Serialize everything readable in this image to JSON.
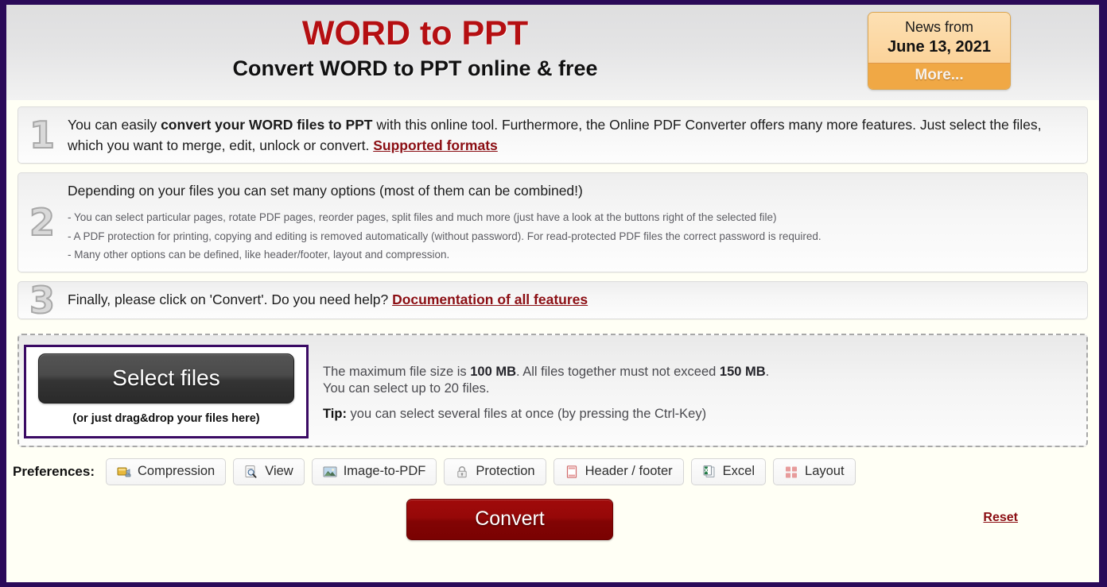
{
  "header": {
    "title": "WORD to PPT",
    "subtitle": "Convert WORD to PPT online & free",
    "news": {
      "line1": "News from",
      "date": "June 13, 2021",
      "more_label": "More..."
    }
  },
  "steps": [
    {
      "number": "1",
      "text_before": "You can easily ",
      "bold": "convert your WORD files to PPT",
      "text_after": " with this online tool. Furthermore, the Online PDF Converter offers many more features. Just select the files, which you want to merge, edit, unlock or convert. ",
      "link": "Supported formats"
    },
    {
      "number": "2",
      "text": "Depending on your files you can set many options (most of them can be combined!)",
      "bullets": [
        "- You can select particular pages, rotate PDF pages, reorder pages, split files and much more (just have a look at the buttons right of the selected file)",
        "- A PDF protection for printing, copying and editing is removed automatically (without password). For read-protected PDF files the correct password is required.",
        "- Many other options can be defined, like header/footer, layout and compression."
      ]
    },
    {
      "number": "3",
      "text": "Finally, please click on 'Convert'. Do you need help? ",
      "link": "Documentation of all features"
    }
  ],
  "dropzone": {
    "select_files_label": "Select files",
    "dragdrop_note": "(or just drag&drop your files here)",
    "info_line1_a": "The maximum file size is ",
    "info_line1_b": "100 MB",
    "info_line1_c": ". All files together must not exceed ",
    "info_line1_d": "150 MB",
    "info_line1_e": ".",
    "info_line2": "You can select up to 20 files.",
    "tip_label": "Tip:",
    "tip_text": " you can select several files at once (by pressing the Ctrl-Key)"
  },
  "preferences": {
    "label": "Preferences:",
    "items": [
      {
        "label": "Compression",
        "icon": "compression-icon"
      },
      {
        "label": "View",
        "icon": "view-magnifier-icon"
      },
      {
        "label": "Image-to-PDF",
        "icon": "image-icon"
      },
      {
        "label": "Protection",
        "icon": "lock-icon"
      },
      {
        "label": "Header / footer",
        "icon": "header-footer-icon"
      },
      {
        "label": "Excel",
        "icon": "excel-icon"
      },
      {
        "label": "Layout",
        "icon": "layout-grid-icon"
      }
    ]
  },
  "actions": {
    "convert_label": "Convert",
    "reset_label": "Reset"
  },
  "colors": {
    "page_border": "#2b0a59",
    "title_red": "#b50f12",
    "link_red": "#8b0e13",
    "news_orange": "#f0a845",
    "news_bg": "#fbd9a3",
    "convert_red": "#960808",
    "select_border_purple": "#3a0a64"
  }
}
